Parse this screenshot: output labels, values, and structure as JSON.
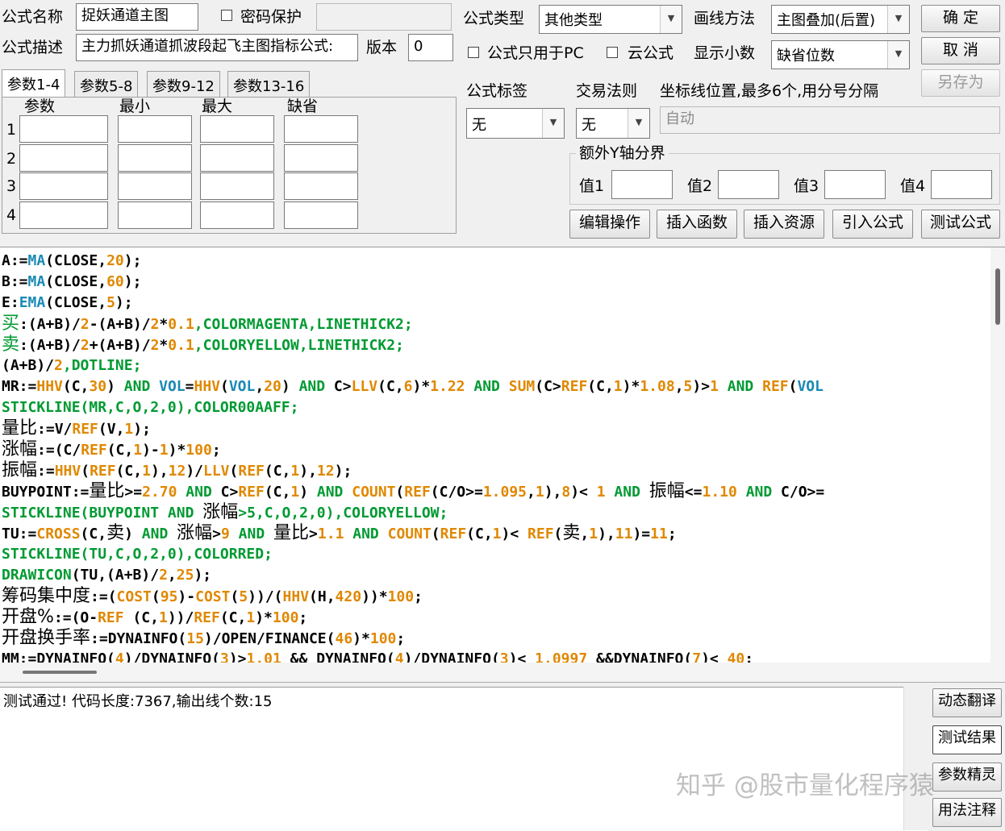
{
  "header": {
    "formula_name_label": "公式名称",
    "formula_name_value": "捉妖通道主图",
    "password_label": "密码保护",
    "password_value": "",
    "formula_desc_label": "公式描述",
    "formula_desc_value": "主力抓妖通道抓波段起飞主图指标公式:",
    "version_label": "版本",
    "version_value": "0",
    "formula_type_label": "公式类型",
    "formula_type_value": "其他类型",
    "draw_method_label": "画线方法",
    "draw_method_value": "主图叠加(后置)",
    "pc_only_label": "公式只用于PC",
    "cloud_label": "云公式",
    "decimals_label": "显示小数",
    "decimals_value": "缺省位数",
    "ok_button": "确 定",
    "cancel_button": "取 消",
    "save_as_button": "另存为"
  },
  "params": {
    "tabs": [
      "参数1-4",
      "参数5-8",
      "参数9-12",
      "参数13-16"
    ],
    "columns": [
      "参数",
      "最小",
      "最大",
      "缺省"
    ],
    "rows": [
      "1",
      "2",
      "3",
      "4"
    ]
  },
  "right": {
    "tag_label": "公式标签",
    "tag_value": "无",
    "trade_rule_label": "交易法则",
    "trade_rule_value": "无",
    "coord_label": "坐标线位置,最多6个,用分号分隔",
    "coord_placeholder": "自动",
    "extra_y_label": "额外Y轴分界",
    "v1": "值1",
    "v2": "值2",
    "v3": "值3",
    "v4": "值4"
  },
  "toolbar": [
    "编辑操作",
    "插入函数",
    "插入资源",
    "引入公式",
    "测试公式"
  ],
  "code": [
    [
      [
        "A:=",
        "k"
      ],
      [
        "MA",
        "f"
      ],
      [
        "(CLOSE,",
        "k"
      ],
      [
        "20",
        "n"
      ],
      [
        ");",
        "k"
      ]
    ],
    [
      [
        "B:=",
        "k"
      ],
      [
        "MA",
        "f"
      ],
      [
        "(CLOSE,",
        "k"
      ],
      [
        "60",
        "n"
      ],
      [
        ");",
        "k"
      ]
    ],
    [
      [
        "E:",
        "k"
      ],
      [
        "EMA",
        "f"
      ],
      [
        "(CLOSE,",
        "k"
      ],
      [
        "5",
        "n"
      ],
      [
        ");",
        "k"
      ]
    ],
    [
      [
        "买",
        "gc"
      ],
      [
        ":(A+B)/",
        "k"
      ],
      [
        "2",
        "n"
      ],
      [
        "-(A+B)/",
        "k"
      ],
      [
        "2",
        "n"
      ],
      [
        "*",
        "k"
      ],
      [
        "0.1",
        "n"
      ],
      [
        ",COLORMAGENTA,LINETHICK2;",
        "g"
      ]
    ],
    [
      [
        "卖",
        "gc"
      ],
      [
        ":(A+B)/",
        "k"
      ],
      [
        "2",
        "n"
      ],
      [
        "+(A+B)/",
        "k"
      ],
      [
        "2",
        "n"
      ],
      [
        "*",
        "k"
      ],
      [
        "0.1",
        "n"
      ],
      [
        ",COLORYELLOW,LINETHICK2;",
        "g"
      ]
    ],
    [
      [
        "(A+B)/",
        "k"
      ],
      [
        "2",
        "n"
      ],
      [
        ",DOTLINE;",
        "g"
      ]
    ],
    [
      [
        "MR:=",
        "k"
      ],
      [
        "HHV",
        "n"
      ],
      [
        "(C,",
        "k"
      ],
      [
        "30",
        "n"
      ],
      [
        ") ",
        "k"
      ],
      [
        "AND",
        "g"
      ],
      [
        " ",
        "k"
      ],
      [
        "VOL",
        "f"
      ],
      [
        "=",
        "k"
      ],
      [
        "HHV",
        "n"
      ],
      [
        "(",
        "k"
      ],
      [
        "VOL",
        "f"
      ],
      [
        ",",
        "k"
      ],
      [
        "20",
        "n"
      ],
      [
        ") ",
        "k"
      ],
      [
        "AND",
        "g"
      ],
      [
        " C>",
        "k"
      ],
      [
        "LLV",
        "n"
      ],
      [
        "(C,",
        "k"
      ],
      [
        "6",
        "n"
      ],
      [
        ")*",
        "k"
      ],
      [
        "1.22",
        "n"
      ],
      [
        " ",
        "k"
      ],
      [
        "AND",
        "g"
      ],
      [
        " ",
        "k"
      ],
      [
        "SUM",
        "n"
      ],
      [
        "(C>",
        "k"
      ],
      [
        "REF",
        "n"
      ],
      [
        "(C,",
        "k"
      ],
      [
        "1",
        "n"
      ],
      [
        ")*",
        "k"
      ],
      [
        "1.08",
        "n"
      ],
      [
        ",",
        "k"
      ],
      [
        "5",
        "n"
      ],
      [
        ")>",
        "k"
      ],
      [
        "1",
        "n"
      ],
      [
        " ",
        "k"
      ],
      [
        "AND",
        "g"
      ],
      [
        " ",
        "k"
      ],
      [
        "REF",
        "n"
      ],
      [
        "(",
        "k"
      ],
      [
        "VOL",
        "f"
      ]
    ],
    [
      [
        "STICKLINE(MR,C,O,2,0),COLOR00AAFF;",
        "g"
      ]
    ],
    [
      [
        "量比",
        "kc"
      ],
      [
        ":=V/",
        "k"
      ],
      [
        "REF",
        "n"
      ],
      [
        "(V,",
        "k"
      ],
      [
        "1",
        "n"
      ],
      [
        ");",
        "k"
      ]
    ],
    [
      [
        "涨幅",
        "kc"
      ],
      [
        ":=(C/",
        "k"
      ],
      [
        "REF",
        "n"
      ],
      [
        "(C,",
        "k"
      ],
      [
        "1",
        "n"
      ],
      [
        ")-",
        "k"
      ],
      [
        "1",
        "n"
      ],
      [
        ")*",
        "k"
      ],
      [
        "100",
        "n"
      ],
      [
        ";",
        "k"
      ]
    ],
    [
      [
        "振幅",
        "kc"
      ],
      [
        ":=",
        "k"
      ],
      [
        "HHV",
        "n"
      ],
      [
        "(",
        "k"
      ],
      [
        "REF",
        "n"
      ],
      [
        "(C,",
        "k"
      ],
      [
        "1",
        "n"
      ],
      [
        "),",
        "k"
      ],
      [
        "12",
        "n"
      ],
      [
        ")/",
        "k"
      ],
      [
        "LLV",
        "n"
      ],
      [
        "(",
        "k"
      ],
      [
        "REF",
        "n"
      ],
      [
        "(C,",
        "k"
      ],
      [
        "1",
        "n"
      ],
      [
        "),",
        "k"
      ],
      [
        "12",
        "n"
      ],
      [
        ");",
        "k"
      ]
    ],
    [
      [
        "BUYPOINT:=",
        "k"
      ],
      [
        "量比",
        "kc"
      ],
      [
        ">=",
        "k"
      ],
      [
        "2.70",
        "n"
      ],
      [
        " ",
        "k"
      ],
      [
        "AND",
        "g"
      ],
      [
        " C>",
        "k"
      ],
      [
        "REF",
        "n"
      ],
      [
        "(C,",
        "k"
      ],
      [
        "1",
        "n"
      ],
      [
        ") ",
        "k"
      ],
      [
        "AND",
        "g"
      ],
      [
        " ",
        "k"
      ],
      [
        "COUNT",
        "n"
      ],
      [
        "(",
        "k"
      ],
      [
        "REF",
        "n"
      ],
      [
        "(C/O>=",
        "k"
      ],
      [
        "1.095",
        "n"
      ],
      [
        ",",
        "k"
      ],
      [
        "1",
        "n"
      ],
      [
        "),",
        "k"
      ],
      [
        "8",
        "n"
      ],
      [
        ")< ",
        "k"
      ],
      [
        "1",
        "n"
      ],
      [
        " ",
        "k"
      ],
      [
        "AND",
        "g"
      ],
      [
        " ",
        "k"
      ],
      [
        "振幅",
        "kc"
      ],
      [
        "<=",
        "k"
      ],
      [
        "1.10",
        "n"
      ],
      [
        " ",
        "k"
      ],
      [
        "AND",
        "g"
      ],
      [
        " C/O>=",
        "k"
      ]
    ],
    [
      [
        "STICKLINE(BUYPOINT AND ",
        "g"
      ],
      [
        "涨幅",
        "kc"
      ],
      [
        ">5,C,O,2,0),COLORYELLOW;",
        "g"
      ]
    ],
    [
      [
        "TU:=",
        "k"
      ],
      [
        "CROSS",
        "n"
      ],
      [
        "(C,",
        "k"
      ],
      [
        "卖",
        "kc"
      ],
      [
        ") ",
        "k"
      ],
      [
        "AND",
        "g"
      ],
      [
        " ",
        "k"
      ],
      [
        "涨幅",
        "kc"
      ],
      [
        ">",
        "k"
      ],
      [
        "9",
        "n"
      ],
      [
        " ",
        "k"
      ],
      [
        "AND",
        "g"
      ],
      [
        " ",
        "k"
      ],
      [
        "量比",
        "kc"
      ],
      [
        ">",
        "k"
      ],
      [
        "1.1",
        "n"
      ],
      [
        " ",
        "k"
      ],
      [
        "AND",
        "g"
      ],
      [
        " ",
        "k"
      ],
      [
        "COUNT",
        "n"
      ],
      [
        "(",
        "k"
      ],
      [
        "REF",
        "n"
      ],
      [
        "(C,",
        "k"
      ],
      [
        "1",
        "n"
      ],
      [
        ")< ",
        "k"
      ],
      [
        "REF",
        "n"
      ],
      [
        "(",
        "k"
      ],
      [
        "卖",
        "kc"
      ],
      [
        ",",
        "k"
      ],
      [
        "1",
        "n"
      ],
      [
        "),",
        "k"
      ],
      [
        "11",
        "n"
      ],
      [
        ")=",
        "k"
      ],
      [
        "11",
        "n"
      ],
      [
        ";",
        "k"
      ]
    ],
    [
      [
        "STICKLINE(TU,C,O,2,0),COLORRED;",
        "g"
      ]
    ],
    [
      [
        "DRAWICON",
        "g"
      ],
      [
        "(TU,(A+B)/",
        "k"
      ],
      [
        "2",
        "n"
      ],
      [
        ",",
        "k"
      ],
      [
        "25",
        "n"
      ],
      [
        ");",
        "k"
      ]
    ],
    [
      [
        "筹码集中度",
        "kc"
      ],
      [
        ":=(",
        "k"
      ],
      [
        "COST",
        "n"
      ],
      [
        "(",
        "k"
      ],
      [
        "95",
        "n"
      ],
      [
        ")-",
        "k"
      ],
      [
        "COST",
        "n"
      ],
      [
        "(",
        "k"
      ],
      [
        "5",
        "n"
      ],
      [
        "))/(",
        "k"
      ],
      [
        "HHV",
        "n"
      ],
      [
        "(H,",
        "k"
      ],
      [
        "420",
        "n"
      ],
      [
        "))*",
        "k"
      ],
      [
        "100",
        "n"
      ],
      [
        ";",
        "k"
      ]
    ],
    [
      [
        "开盘%",
        "kc"
      ],
      [
        ":=(O-",
        "k"
      ],
      [
        "REF",
        "n"
      ],
      [
        " (C,",
        "k"
      ],
      [
        "1",
        "n"
      ],
      [
        "))/",
        "k"
      ],
      [
        "REF",
        "n"
      ],
      [
        "(C,",
        "k"
      ],
      [
        "1",
        "n"
      ],
      [
        ")*",
        "k"
      ],
      [
        "100",
        "n"
      ],
      [
        ";",
        "k"
      ]
    ],
    [
      [
        "开盘换手率",
        "kc"
      ],
      [
        ":=DYNAINFO(",
        "k"
      ],
      [
        "15",
        "n"
      ],
      [
        ")/OPEN/FINANCE(",
        "k"
      ],
      [
        "46",
        "n"
      ],
      [
        ")*",
        "k"
      ],
      [
        "100",
        "n"
      ],
      [
        ";",
        "k"
      ]
    ],
    [
      [
        "MM:=DYNAINFO(",
        "k"
      ],
      [
        "4",
        "n"
      ],
      [
        ")/DYNAINFO(",
        "k"
      ],
      [
        "3",
        "n"
      ],
      [
        ")>",
        "k"
      ],
      [
        "1.01",
        "n"
      ],
      [
        " && DYNAINFO(",
        "k"
      ],
      [
        "4",
        "n"
      ],
      [
        ")/DYNAINFO(",
        "k"
      ],
      [
        "3",
        "n"
      ],
      [
        ")< ",
        "k"
      ],
      [
        "1.0997",
        "n"
      ],
      [
        " &&DYNAINFO(",
        "k"
      ],
      [
        "7",
        "n"
      ],
      [
        ")< ",
        "k"
      ],
      [
        "40",
        "n"
      ],
      [
        ";",
        "k"
      ]
    ]
  ],
  "status_text": "测试通过! 代码长度:7367,输出线个数:15",
  "side_buttons": [
    "动态翻译",
    "测试结果",
    "参数精灵",
    "用法注释"
  ],
  "watermark": "知乎 @股市量化程序猿"
}
